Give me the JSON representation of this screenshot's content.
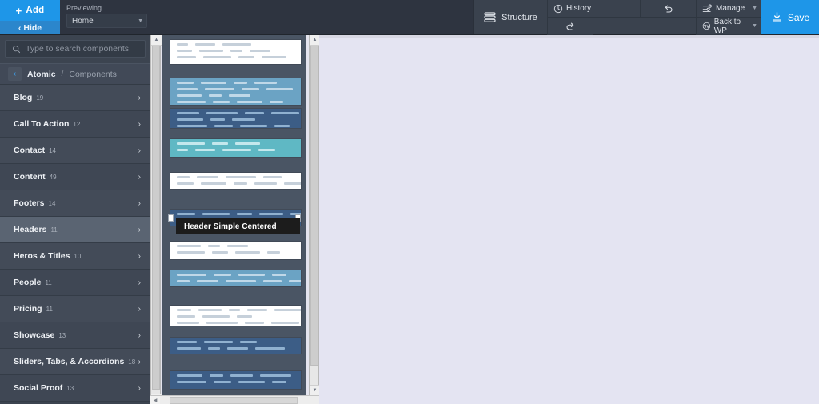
{
  "topbar": {
    "add_label": "Add",
    "hide_label": "Hide",
    "previewing_label": "Previewing",
    "previewing_value": "Home",
    "structure_label": "Structure",
    "history_label": "History",
    "manage_label": "Manage",
    "back_to_wp_label": "Back to WP",
    "save_label": "Save",
    "undo_label": "Undo",
    "redo_label": "Redo"
  },
  "search": {
    "placeholder": "Type to search components",
    "value": ""
  },
  "breadcrumb": {
    "back_label": "Back",
    "current": "Atomic",
    "separator": "/",
    "parent": "Components"
  },
  "categories": [
    {
      "label": "Blog",
      "count": "19"
    },
    {
      "label": "Call To Action",
      "count": "12"
    },
    {
      "label": "Contact",
      "count": "14"
    },
    {
      "label": "Content",
      "count": "49"
    },
    {
      "label": "Footers",
      "count": "14"
    },
    {
      "label": "Headers",
      "count": "11"
    },
    {
      "label": "Heros & Titles",
      "count": "10"
    },
    {
      "label": "People",
      "count": "11"
    },
    {
      "label": "Pricing",
      "count": "11"
    },
    {
      "label": "Showcase",
      "count": "13"
    },
    {
      "label": "Sliders, Tabs, & Accordions",
      "count": "18"
    },
    {
      "label": "Social Proof",
      "count": "13"
    }
  ],
  "active_category": "Headers",
  "tooltip": {
    "text": "Header Simple Centered"
  },
  "colors": {
    "accent": "#1e96e8",
    "topbar_bg": "#2e3440",
    "panel_bg": "#3c4450",
    "row_bg": "#434b58",
    "row_active_bg": "#5a6472",
    "canvas_bg": "#e4e4f2",
    "tooltip_bg": "#1c1c1c"
  },
  "thumbnails": [
    {
      "name": "header-logo-contact-bar",
      "style": "light",
      "selected": false
    },
    {
      "name": "header-blue-three-column",
      "style": "blue",
      "selected": false
    },
    {
      "name": "header-dark-nav-bar",
      "style": "dark",
      "selected": false
    },
    {
      "name": "header-teal-split-nav",
      "style": "teal",
      "selected": false
    },
    {
      "name": "header-white-centered",
      "style": "light",
      "selected": false
    },
    {
      "name": "header-simple-centered",
      "style": "dark",
      "selected": true
    },
    {
      "name": "header-light-inline-nav",
      "style": "light",
      "selected": false
    },
    {
      "name": "header-blue-contact-strip",
      "style": "blue",
      "selected": false
    },
    {
      "name": "header-social-top-bar",
      "style": "light",
      "selected": false
    },
    {
      "name": "header-dark-button-nav",
      "style": "dark",
      "selected": false
    },
    {
      "name": "header-dark-wide-nav",
      "style": "dark",
      "selected": false
    }
  ],
  "canvas": {
    "content": ""
  }
}
